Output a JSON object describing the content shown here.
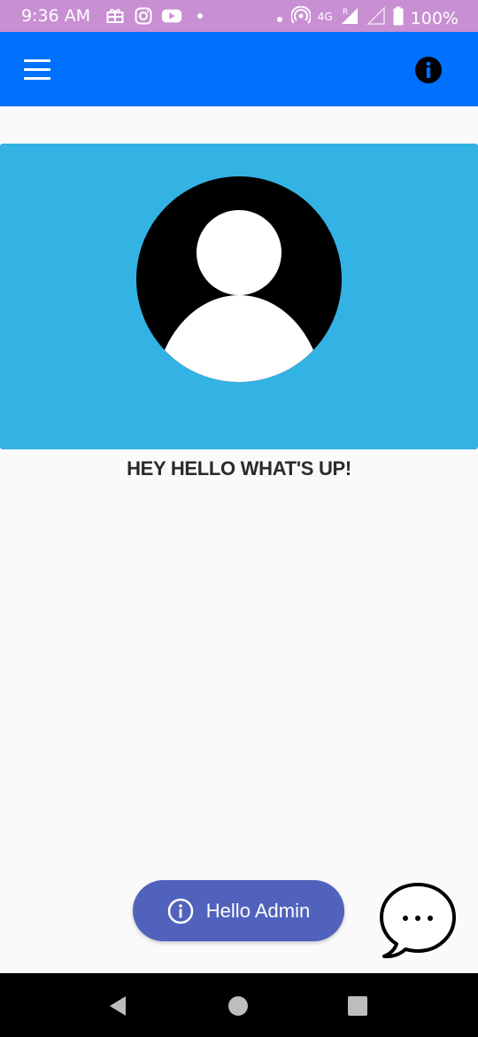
{
  "status_bar": {
    "time": "9:36 AM",
    "left_icons": [
      "gift-icon",
      "instagram-icon",
      "youtube-icon",
      "dot-icon"
    ],
    "right_icons": [
      "dot-icon",
      "hotspot-icon",
      "signal-icon",
      "signal-empty-icon",
      "battery-icon"
    ],
    "network": "4G",
    "roaming": "R",
    "battery": "100%",
    "color": "#c98fd3"
  },
  "app_bar": {
    "color": "#0070ff",
    "menu_icon": "hamburger-menu-icon",
    "info_icon": "info-icon"
  },
  "profile": {
    "banner_color": "#33b3e3",
    "avatar_icon": "avatar-placeholder-icon",
    "greeting": "HEY HELLO WHAT'S UP!"
  },
  "admin_button": {
    "label": "Hello Admin",
    "icon": "info-outline-icon",
    "color": "#5062bb"
  },
  "chat_button": {
    "icon": "chat-bubble-icon"
  },
  "nav_bar": {
    "back": "back-triangle-icon",
    "home": "home-circle-icon",
    "recents": "recents-square-icon"
  }
}
